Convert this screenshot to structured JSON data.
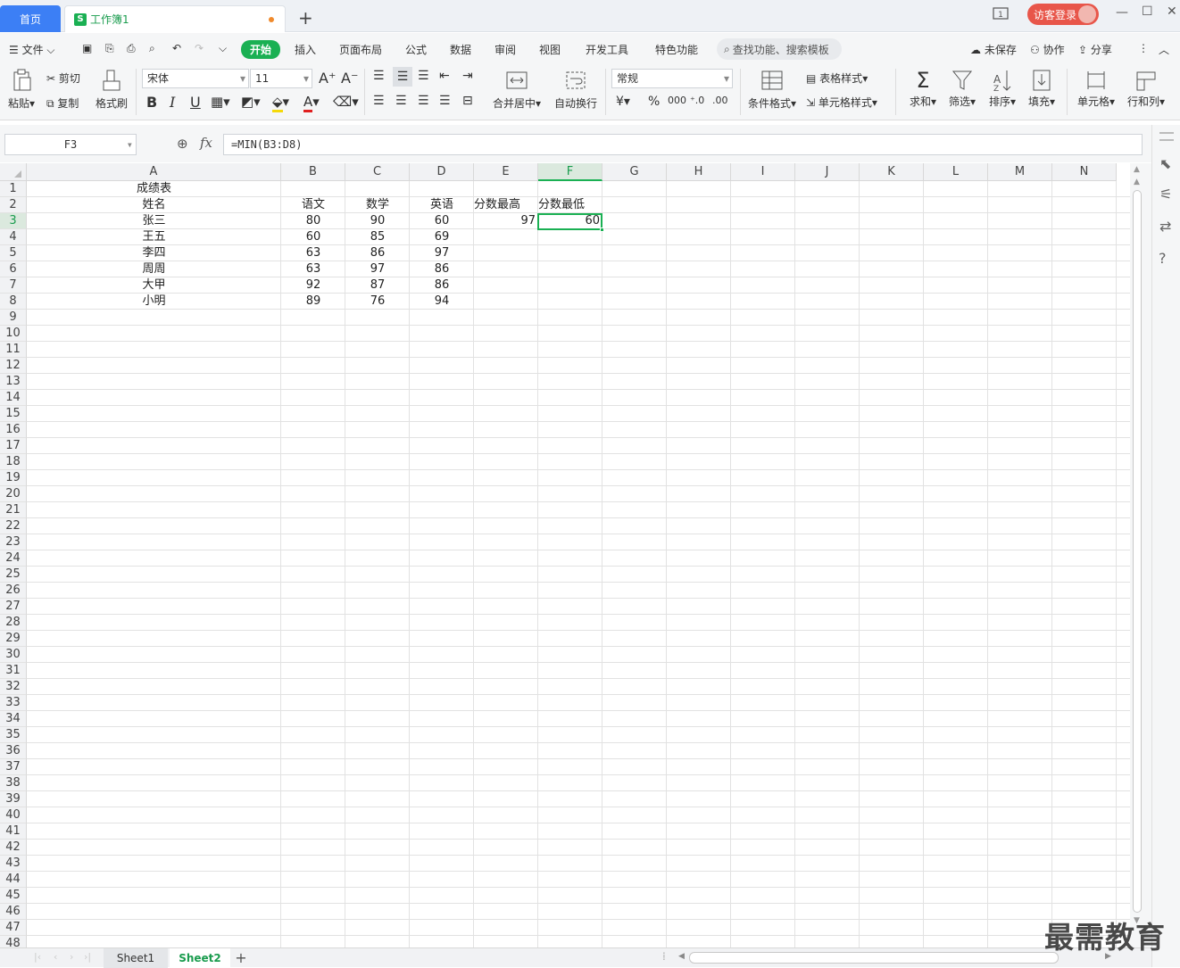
{
  "titlebar": {
    "home_tab": "首页",
    "doc_tab": "工作簿1",
    "guest_login": "访客登录"
  },
  "menu": {
    "file": "文件",
    "items": [
      "开始",
      "插入",
      "页面布局",
      "公式",
      "数据",
      "审阅",
      "视图",
      "开发工具",
      "特色功能"
    ],
    "search": "查找功能、搜索模板",
    "unsaved": "未保存",
    "collab": "协作",
    "share": "分享"
  },
  "ribbon": {
    "paste": "粘贴",
    "cut": "剪切",
    "copy": "复制",
    "format_painter": "格式刷",
    "font_name": "宋体",
    "font_size": "11",
    "merge_center": "合并居中",
    "wrap_text": "自动换行",
    "number_format": "常规",
    "cond_format": "条件格式",
    "table_style": "表格样式",
    "cell_style": "单元格样式",
    "sum": "求和",
    "filter": "筛选",
    "sort": "排序",
    "fill": "填充",
    "cell": "单元格",
    "row_col": "行和列"
  },
  "formula": {
    "name_box": "F3",
    "fx": "fx",
    "content": "=MIN(B3:D8)"
  },
  "grid": {
    "columns": [
      "A",
      "B",
      "C",
      "D",
      "E",
      "F",
      "G",
      "H",
      "I",
      "J",
      "K",
      "L",
      "M",
      "N"
    ],
    "selected_column": "F",
    "selected_row": 3,
    "row_count": 48,
    "title": "成绩表",
    "headers": [
      "姓名",
      "语文",
      "数学",
      "英语",
      "分数最高",
      "分数最低"
    ],
    "rows": [
      [
        "张三",
        "80",
        "90",
        "60",
        "97",
        "60"
      ],
      [
        "王五",
        "60",
        "85",
        "69",
        "",
        ""
      ],
      [
        "李四",
        "63",
        "86",
        "97",
        "",
        ""
      ],
      [
        "周周",
        "63",
        "97",
        "86",
        "",
        ""
      ],
      [
        "大甲",
        "92",
        "87",
        "86",
        "",
        ""
      ],
      [
        "小明",
        "89",
        "76",
        "94",
        "",
        ""
      ]
    ]
  },
  "sheets": [
    "Sheet1",
    "Sheet2"
  ],
  "active_sheet": "Sheet2",
  "watermark": "最需教育",
  "colors": {
    "accent": "#1ab053",
    "home_tab": "#3c7ff5",
    "guest_btn": "#e8564a"
  }
}
